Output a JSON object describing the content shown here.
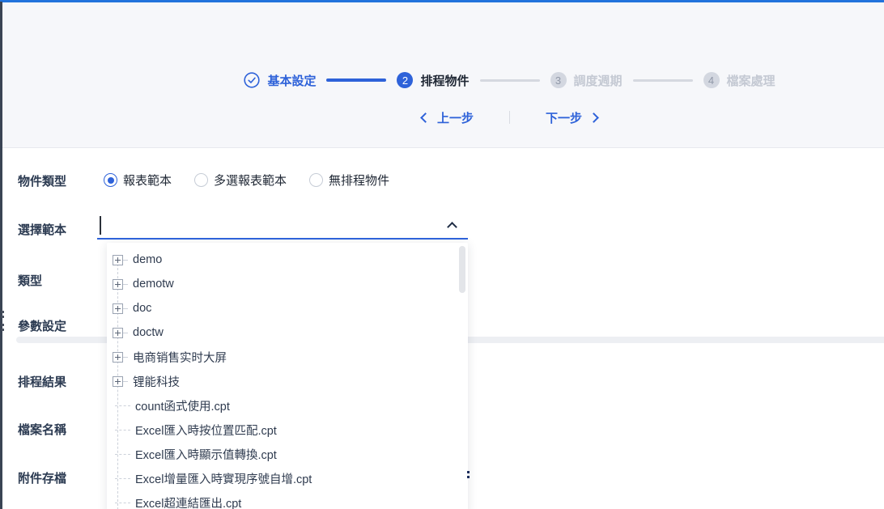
{
  "colors": {
    "accent": "#2e62d9",
    "top_bar": "#2273dc",
    "left_strip": "#3a4454",
    "pending_gray": "#d3d7e0"
  },
  "header": {
    "steps": [
      {
        "label": "基本設定",
        "state": "done"
      },
      {
        "number": "2",
        "label": "排程物件",
        "state": "active"
      },
      {
        "number": "3",
        "label": "調度週期",
        "state": "pending"
      },
      {
        "number": "4",
        "label": "檔案處理",
        "state": "pending"
      }
    ],
    "prev_label": "上一步",
    "next_label": "下一步"
  },
  "form": {
    "object_type_label": "物件類型",
    "object_type_options": [
      {
        "label": "報表範本",
        "selected": true
      },
      {
        "label": "多選報表範本",
        "selected": false
      },
      {
        "label": "無排程物件",
        "selected": false
      }
    ],
    "select_template_label": "選擇範本",
    "select_template_value": "",
    "type_label": "類型",
    "param_label": "參數設定",
    "result_label": "排程結果",
    "filename_label": "檔案名稱",
    "attachment_label": "附件存檔"
  },
  "dropdown": {
    "items": [
      {
        "type": "folder",
        "label": "demo"
      },
      {
        "type": "folder",
        "label": "demotw"
      },
      {
        "type": "folder",
        "label": "doc"
      },
      {
        "type": "folder",
        "label": "doctw"
      },
      {
        "type": "folder",
        "label": "电商销售实时大屏"
      },
      {
        "type": "folder",
        "label": "锂能科技"
      },
      {
        "type": "file",
        "label": "count函式使用.cpt"
      },
      {
        "type": "file",
        "label": "Excel匯入時按位置匹配.cpt"
      },
      {
        "type": "file",
        "label": "Excel匯入時顯示值轉換.cpt"
      },
      {
        "type": "file",
        "label": "Excel增量匯入時實現序號自增.cpt"
      },
      {
        "type": "file",
        "label": "Excel超連結匯出.cpt"
      }
    ]
  }
}
